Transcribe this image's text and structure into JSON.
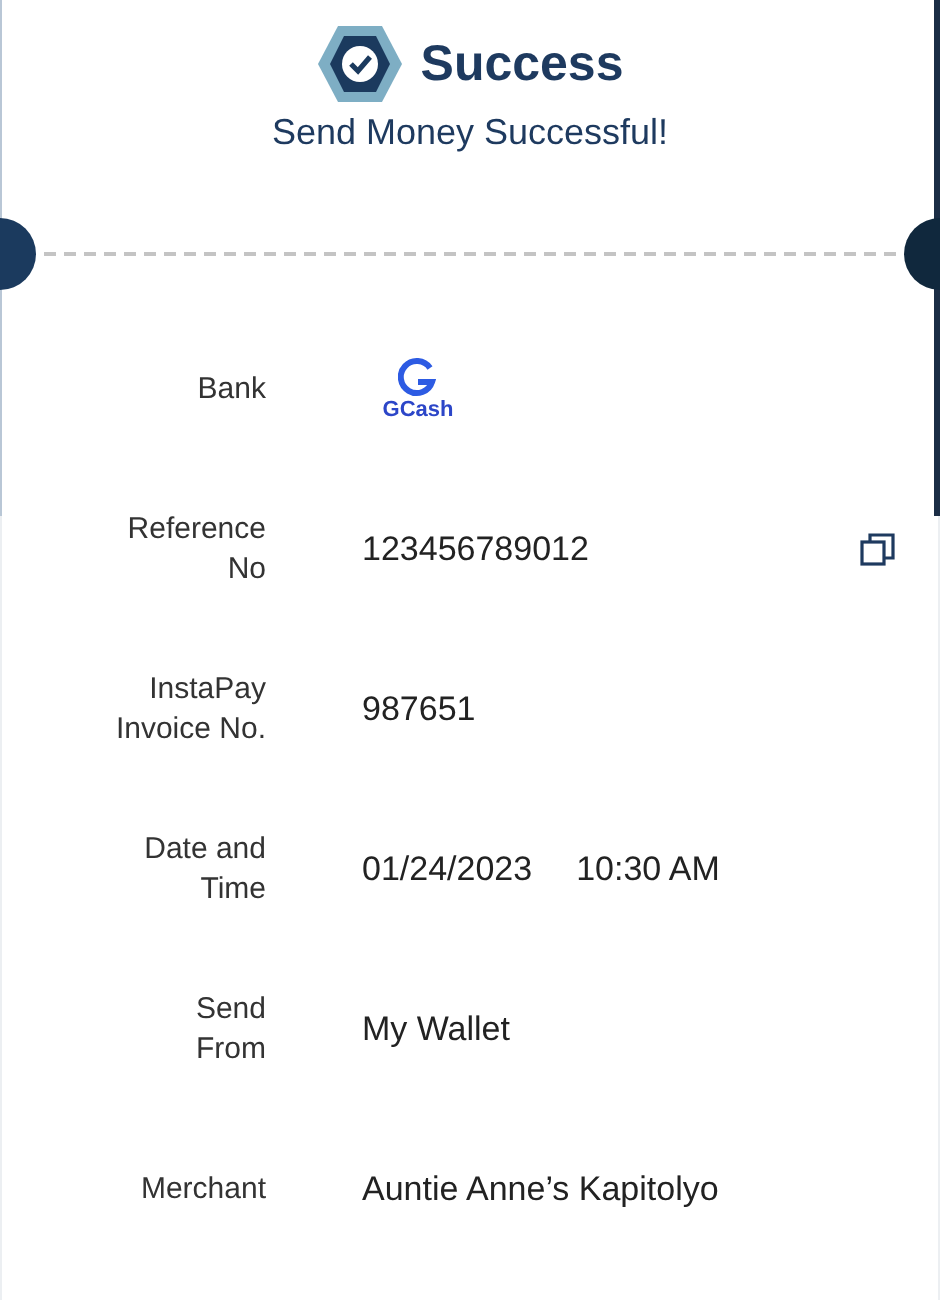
{
  "header": {
    "title": "Success",
    "subtitle": "Send Money Successful!"
  },
  "details": [
    {
      "label": [
        "Bank"
      ],
      "kind": "logo",
      "value": "GCash",
      "copyable": false
    },
    {
      "label": [
        "Reference",
        "No"
      ],
      "kind": "text",
      "value": "123456789012",
      "copyable": true
    },
    {
      "label": [
        "InstaPay",
        "Invoice No."
      ],
      "kind": "text",
      "value": "987651",
      "copyable": false
    },
    {
      "label": [
        "Date and",
        "Time"
      ],
      "kind": "date_time",
      "value": "01/24/2023",
      "time": "10:30 AM",
      "copyable": false
    },
    {
      "label": [
        "Send",
        "From"
      ],
      "kind": "text",
      "value": "My Wallet",
      "copyable": false
    },
    {
      "label": [
        "Merchant"
      ],
      "kind": "text",
      "value": "Auntie Anne’s Kapitolyo",
      "copyable": false
    }
  ]
}
